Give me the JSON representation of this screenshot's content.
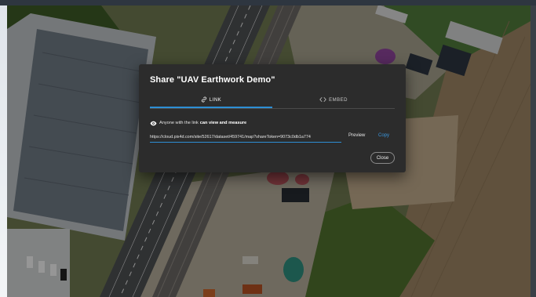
{
  "dialog": {
    "title": "Share \"UAV Earthwork Demo\"",
    "tabs": [
      {
        "label": "LINK",
        "icon": "link-icon",
        "active": true
      },
      {
        "label": "EMBED",
        "icon": "code-icon",
        "active": false
      }
    ],
    "permission_prefix": "Anyone with the link",
    "permission_bold": "can view and measure",
    "share_url": "https://cloud.pix4d.com/site/52617/dataset/459741/map?shareToken=9073c0db1a774",
    "preview_label": "Preview",
    "copy_label": "Copy",
    "close_label": "Close"
  },
  "colors": {
    "accent": "#2d8fd5",
    "dialog_bg": "#2c2c2c"
  }
}
